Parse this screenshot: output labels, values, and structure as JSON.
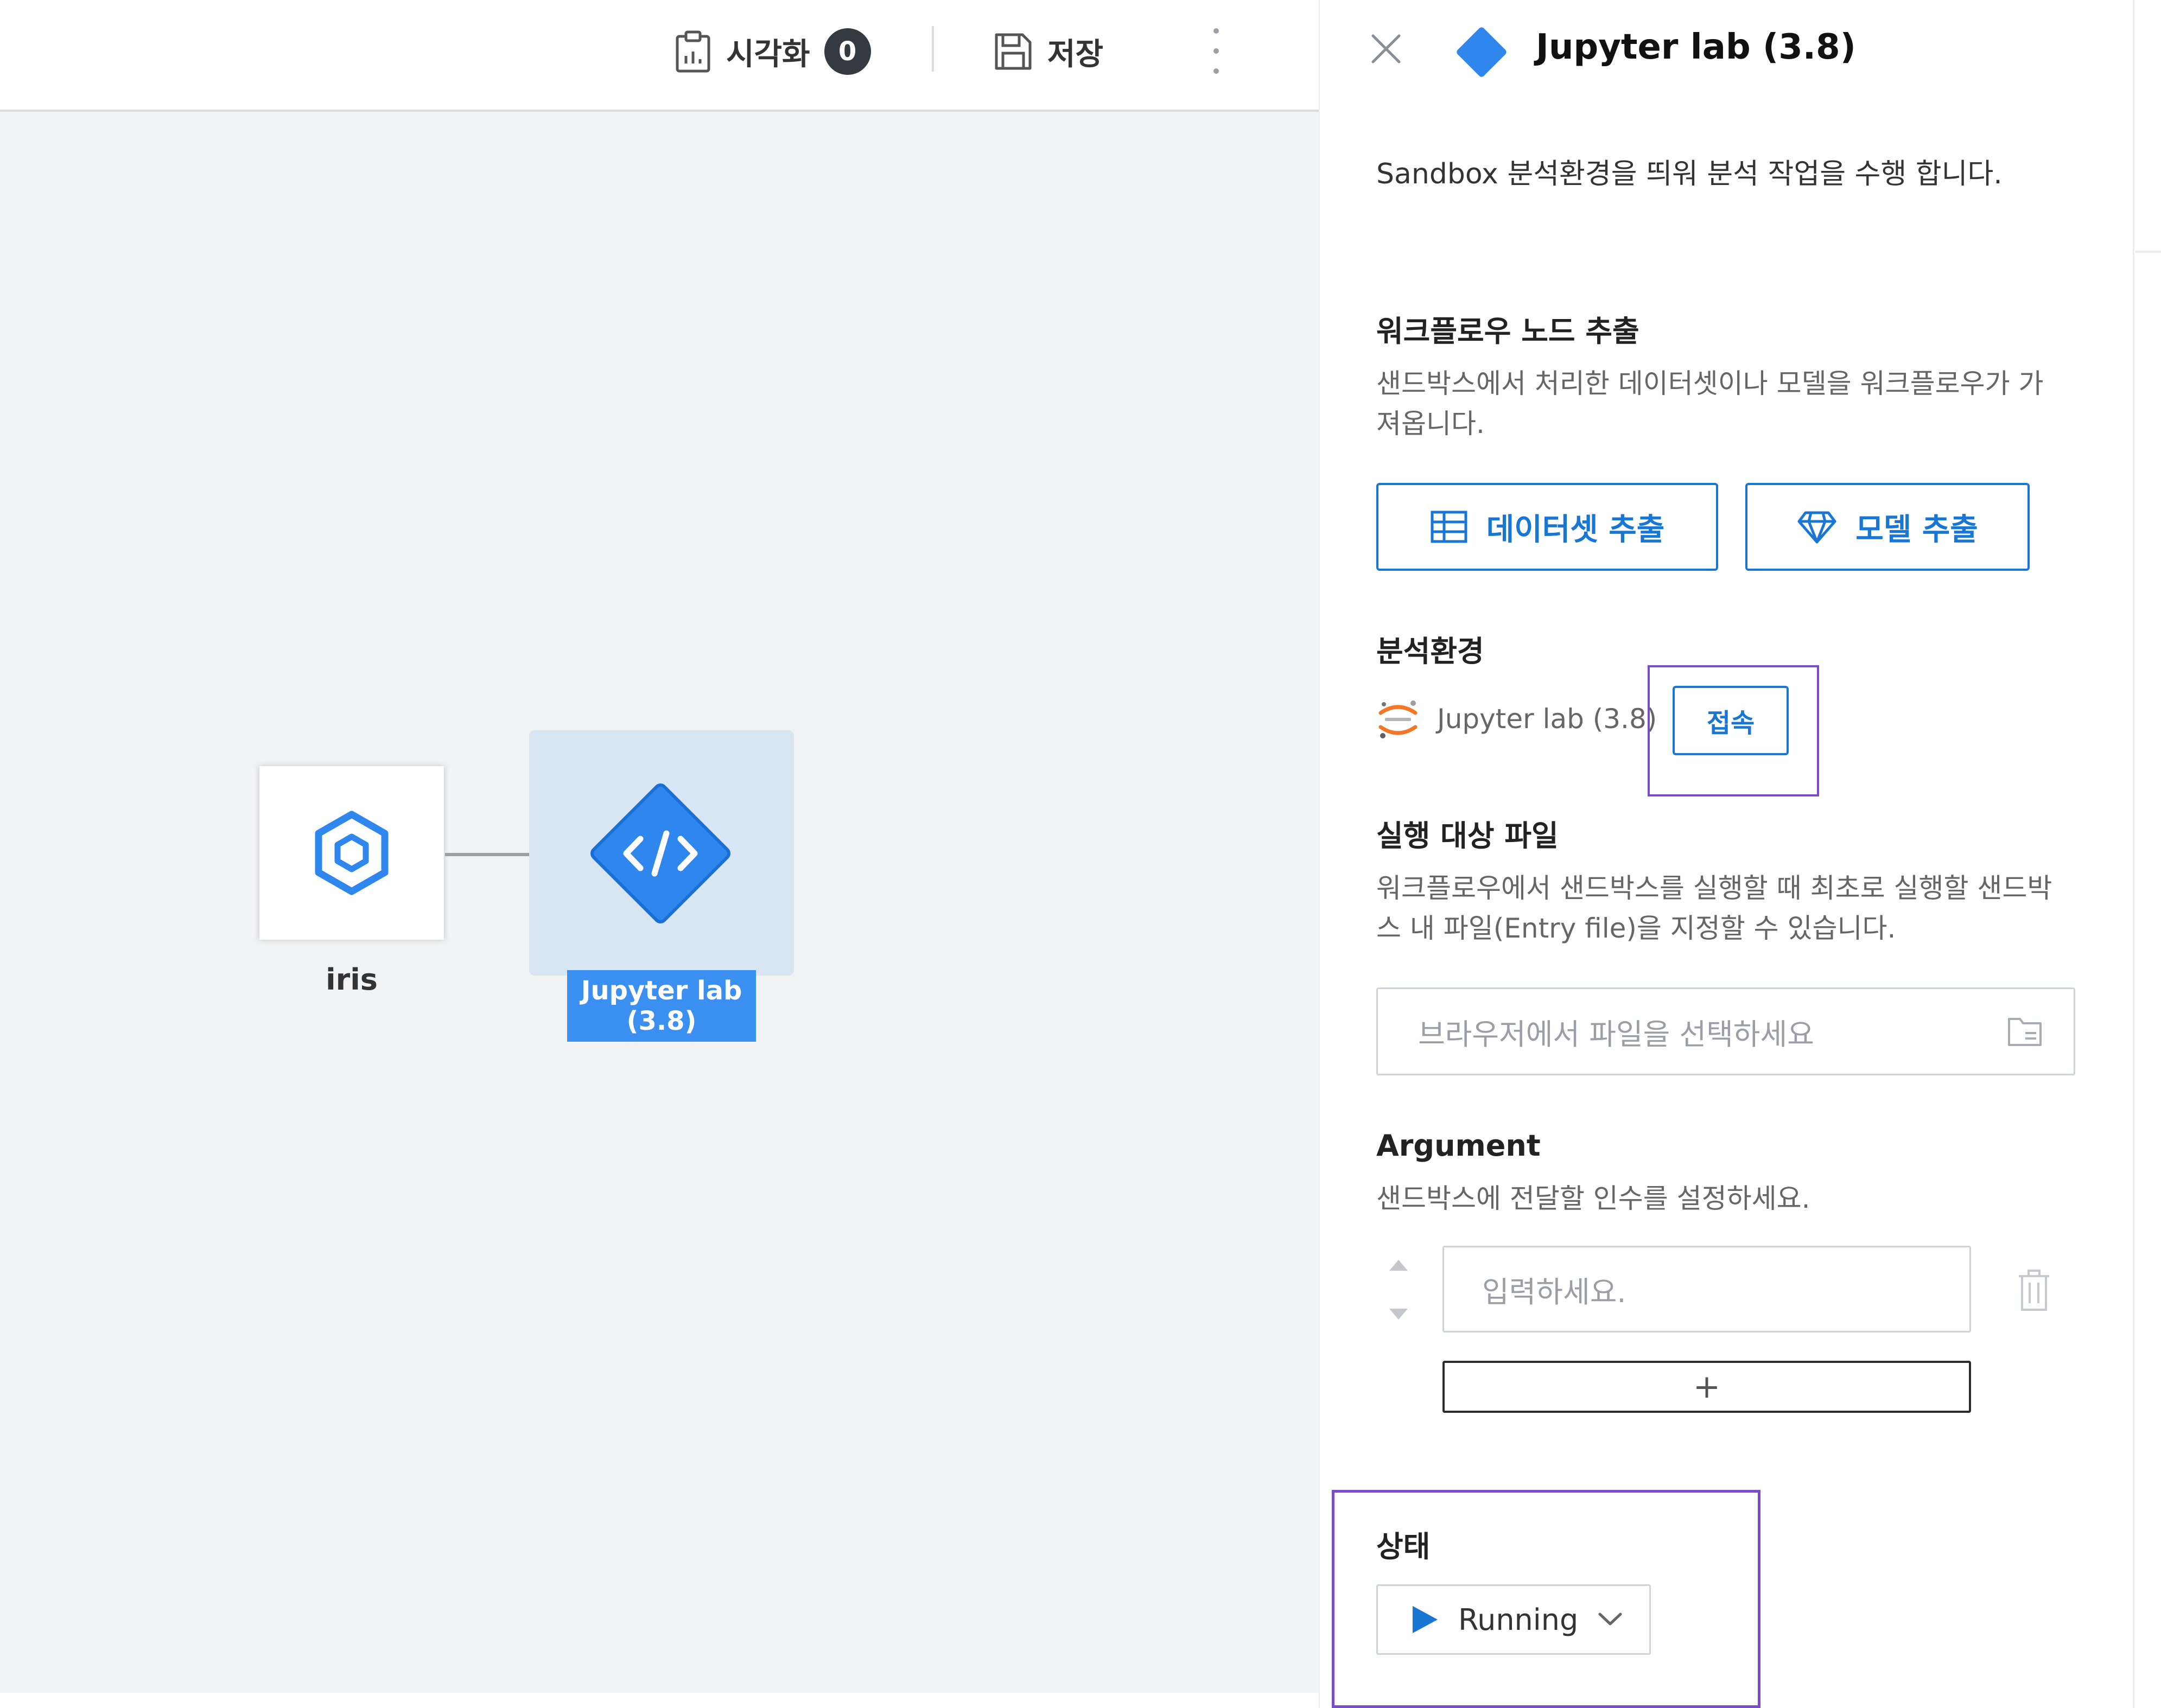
{
  "toolbar": {
    "visualize_label": "시각화",
    "visualize_count": "0",
    "save_label": "저장"
  },
  "workflow": {
    "nodes": [
      {
        "label": "iris",
        "type": "dataset",
        "icon": "hexagon-icon"
      },
      {
        "label": "Jupyter lab (3.8)",
        "label_line1": "Jupyter lab",
        "label_line2": "(3.8)",
        "type": "sandbox",
        "icon": "code-icon",
        "selected": true
      }
    ]
  },
  "panel": {
    "title": "Jupyter lab (3.8)",
    "description": "Sandbox 분석환경을 띄워 분석 작업을 수행 합니다.",
    "extract": {
      "title": "워크플로우 노드 추출",
      "desc_line1": "샌드박스에서 처리한 데이터셋이나 모델을 워크플로우가 가",
      "desc_line2": "져옵니다.",
      "dataset_button": "데이터셋 추출",
      "model_button": "모델 추출"
    },
    "env": {
      "title": "분석환경",
      "name": "Jupyter lab (3.8)",
      "connect_button": "접속"
    },
    "entry": {
      "title": "실행 대상 파일",
      "desc_line1": "워크플로우에서 샌드박스를 실행할 때 최초로 실행할 샌드박",
      "desc_line2": "스 내 파일(Entry file)을 지정할 수 있습니다.",
      "placeholder": "브라우저에서 파일을 선택하세요"
    },
    "argument": {
      "title": "Argument",
      "desc": "샌드박스에 전달할 인수를 설정하세요.",
      "placeholder": "입력하세요.",
      "add_label": "+"
    },
    "status": {
      "title": "상태",
      "value": "Running"
    }
  },
  "colors": {
    "accent": "#1976d2",
    "node_blue": "#2f86ec",
    "highlight": "#7a4cc9",
    "canvas_bg": "#f1f2f4"
  }
}
